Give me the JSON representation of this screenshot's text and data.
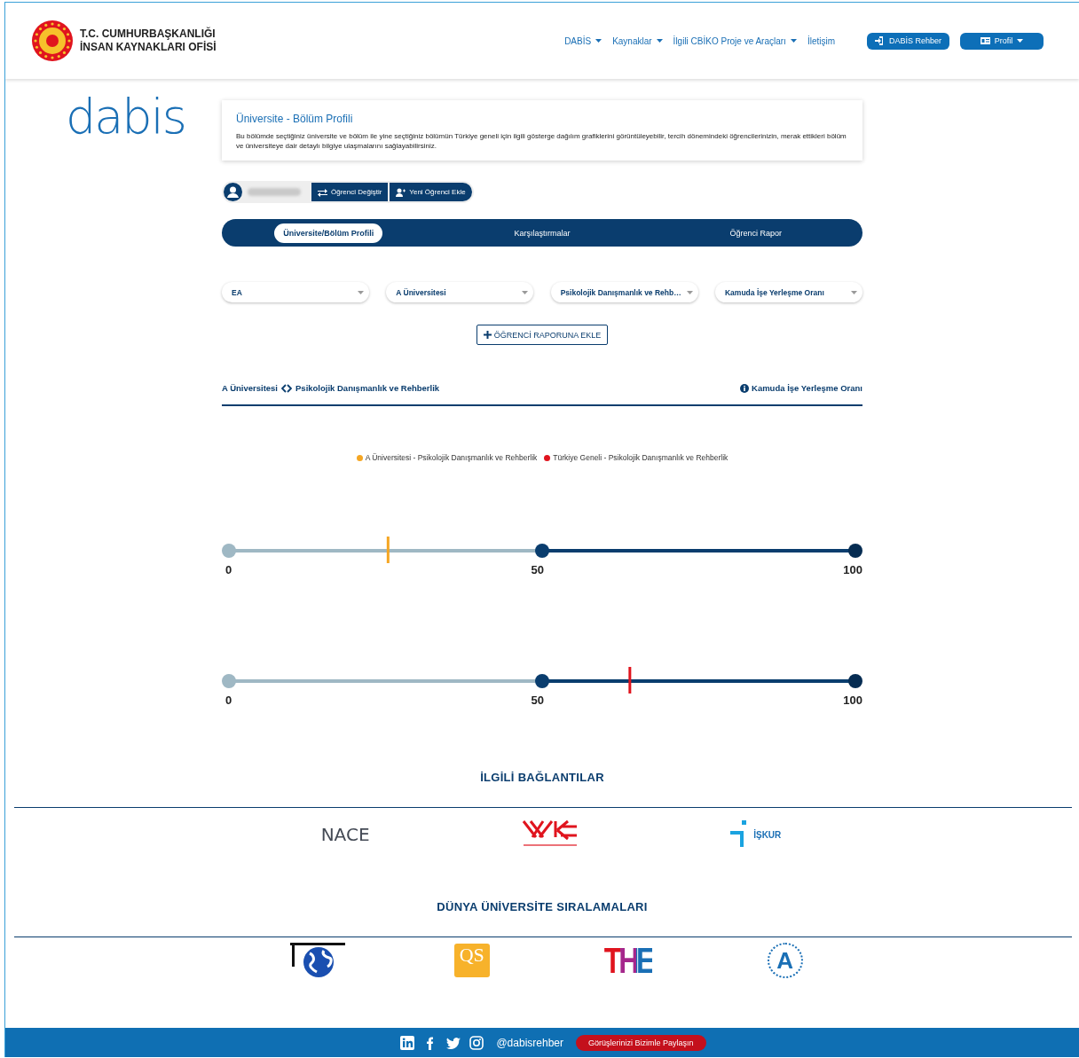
{
  "header": {
    "org_line1": "T.C. CUMHURBAŞKANLIĞI",
    "org_line2": "İNSAN KAYNAKLARI OFİSİ",
    "nav": [
      {
        "label": "DABİS",
        "dropdown": true
      },
      {
        "label": "Kaynaklar",
        "dropdown": true
      },
      {
        "label": "İlgili CBİKO Proje ve Araçları",
        "dropdown": true
      },
      {
        "label": "İletişim",
        "dropdown": false
      }
    ],
    "buttons": [
      {
        "kind": "guide",
        "label": "DABİS Rehber"
      },
      {
        "kind": "profile",
        "label": "Profil"
      }
    ]
  },
  "brand": "dabis",
  "info": {
    "title": "Üniversite - Bölüm Profili",
    "text": "Bu bölümde seçtiğiniz üniversite ve bölüm ile yine seçtiğiniz bölümün Türkiye geneli için ilgili gösterge dağılım grafiklerini görüntüleyebilir, tercih dönemindeki öğrencilerinizin, merak ettikleri bölüm ve üniversiteye dair detaylı bilgiye ulaşmalarını sağlayabilirsiniz."
  },
  "student_bar": {
    "buttons": [
      {
        "kind": "switch",
        "label": "Öğrenci Değiştir"
      },
      {
        "kind": "add",
        "label": "Yeni Öğrenci Ekle"
      }
    ]
  },
  "tabs": [
    {
      "label": "Üniversite/Bölüm Profili",
      "selected": true
    },
    {
      "label": "Karşılaştırmalar",
      "selected": false
    },
    {
      "label": "Öğrenci Rapor",
      "selected": false
    }
  ],
  "filters": [
    {
      "value": "EA"
    },
    {
      "value": "A Üniversitesi"
    },
    {
      "value": "Psikolojik Danışmanlık ve Rehb…"
    },
    {
      "value": "Kamuda İşe Yerleşme Oranı"
    }
  ],
  "add_button": "ÖĞRENCİ RAPORUNA EKLE",
  "result": {
    "university": "A Üniversitesi",
    "department": "Psikolojik Danışmanlık ve Rehberlik",
    "indicator": "Kamuda İşe Yerleşme Oranı"
  },
  "legend": [
    {
      "label": "A Üniversitesi - Psikolojik Danışmanlık ve Rehberlik",
      "color": "#f5a623"
    },
    {
      "label": "Türkiye Geneli - Psikolojik Danışmanlık ve Rehberlik",
      "color": "#e0141e"
    }
  ],
  "gauges": [
    {
      "level": 0.254,
      "color": "#f5a623",
      "ticks": [
        "0",
        "50",
        "100"
      ]
    },
    {
      "level": 0.64,
      "color": "#e0141e",
      "ticks": [
        "0",
        "50",
        "100"
      ]
    }
  ],
  "related_links": {
    "title": "İLGİLİ BAĞLANTILAR",
    "logos": [
      {
        "kind": "nace",
        "text": "NACE"
      },
      {
        "kind": "yok"
      },
      {
        "kind": "iskur",
        "text": "İŞKUR"
      }
    ]
  },
  "rankings": {
    "title": "DÜNYA ÜNİVERSİTE SIRALAMALARI",
    "logos": [
      {
        "kind": "globe"
      },
      {
        "kind": "qs",
        "text": "QS"
      },
      {
        "kind": "the",
        "text": "THE"
      },
      {
        "kind": "arwu",
        "text": "A"
      }
    ]
  },
  "footer": {
    "social": [
      {
        "kind": "linkedin"
      },
      {
        "kind": "facebook"
      },
      {
        "kind": "twitter"
      },
      {
        "kind": "instagram"
      }
    ],
    "handle": "@dabisrehber",
    "feedback": "Görüşlerinizi Bizimle Paylaşın"
  }
}
